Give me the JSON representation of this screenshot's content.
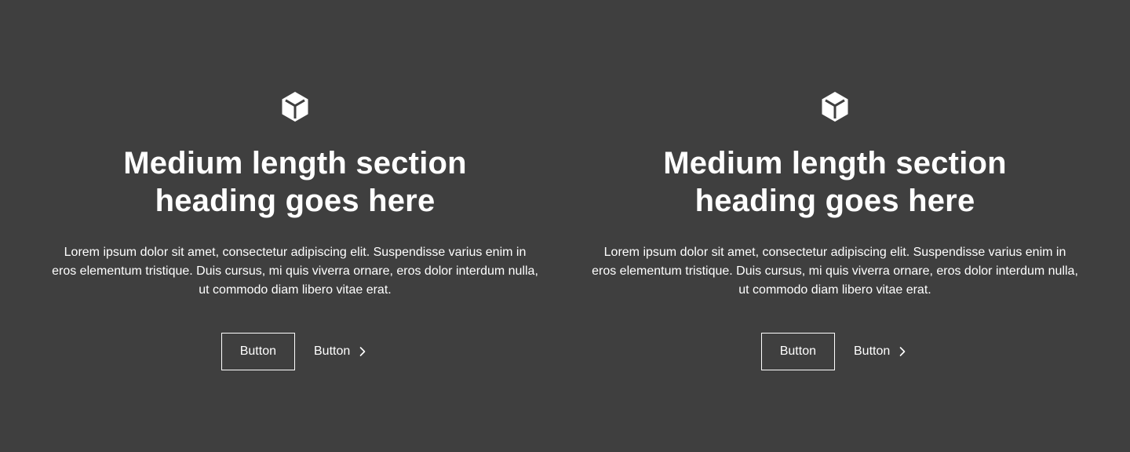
{
  "colors": {
    "background": "#3f3f3f",
    "foreground": "#ffffff"
  },
  "columns": [
    {
      "icon": "cube-icon",
      "heading": "Medium length section heading goes here",
      "body": "Lorem ipsum dolor sit amet, consectetur adipiscing elit. Suspendisse varius enim in eros elementum tristique. Duis cursus, mi quis viverra ornare, eros dolor interdum nulla, ut commodo diam libero vitae erat.",
      "primary_button_label": "Button",
      "secondary_button_label": "Button",
      "secondary_button_icon": "chevron-right-icon"
    },
    {
      "icon": "cube-icon",
      "heading": "Medium length section heading goes here",
      "body": "Lorem ipsum dolor sit amet, consectetur adipiscing elit. Suspendisse varius enim in eros elementum tristique. Duis cursus, mi quis viverra ornare, eros dolor interdum nulla, ut commodo diam libero vitae erat.",
      "primary_button_label": "Button",
      "secondary_button_label": "Button",
      "secondary_button_icon": "chevron-right-icon"
    }
  ]
}
